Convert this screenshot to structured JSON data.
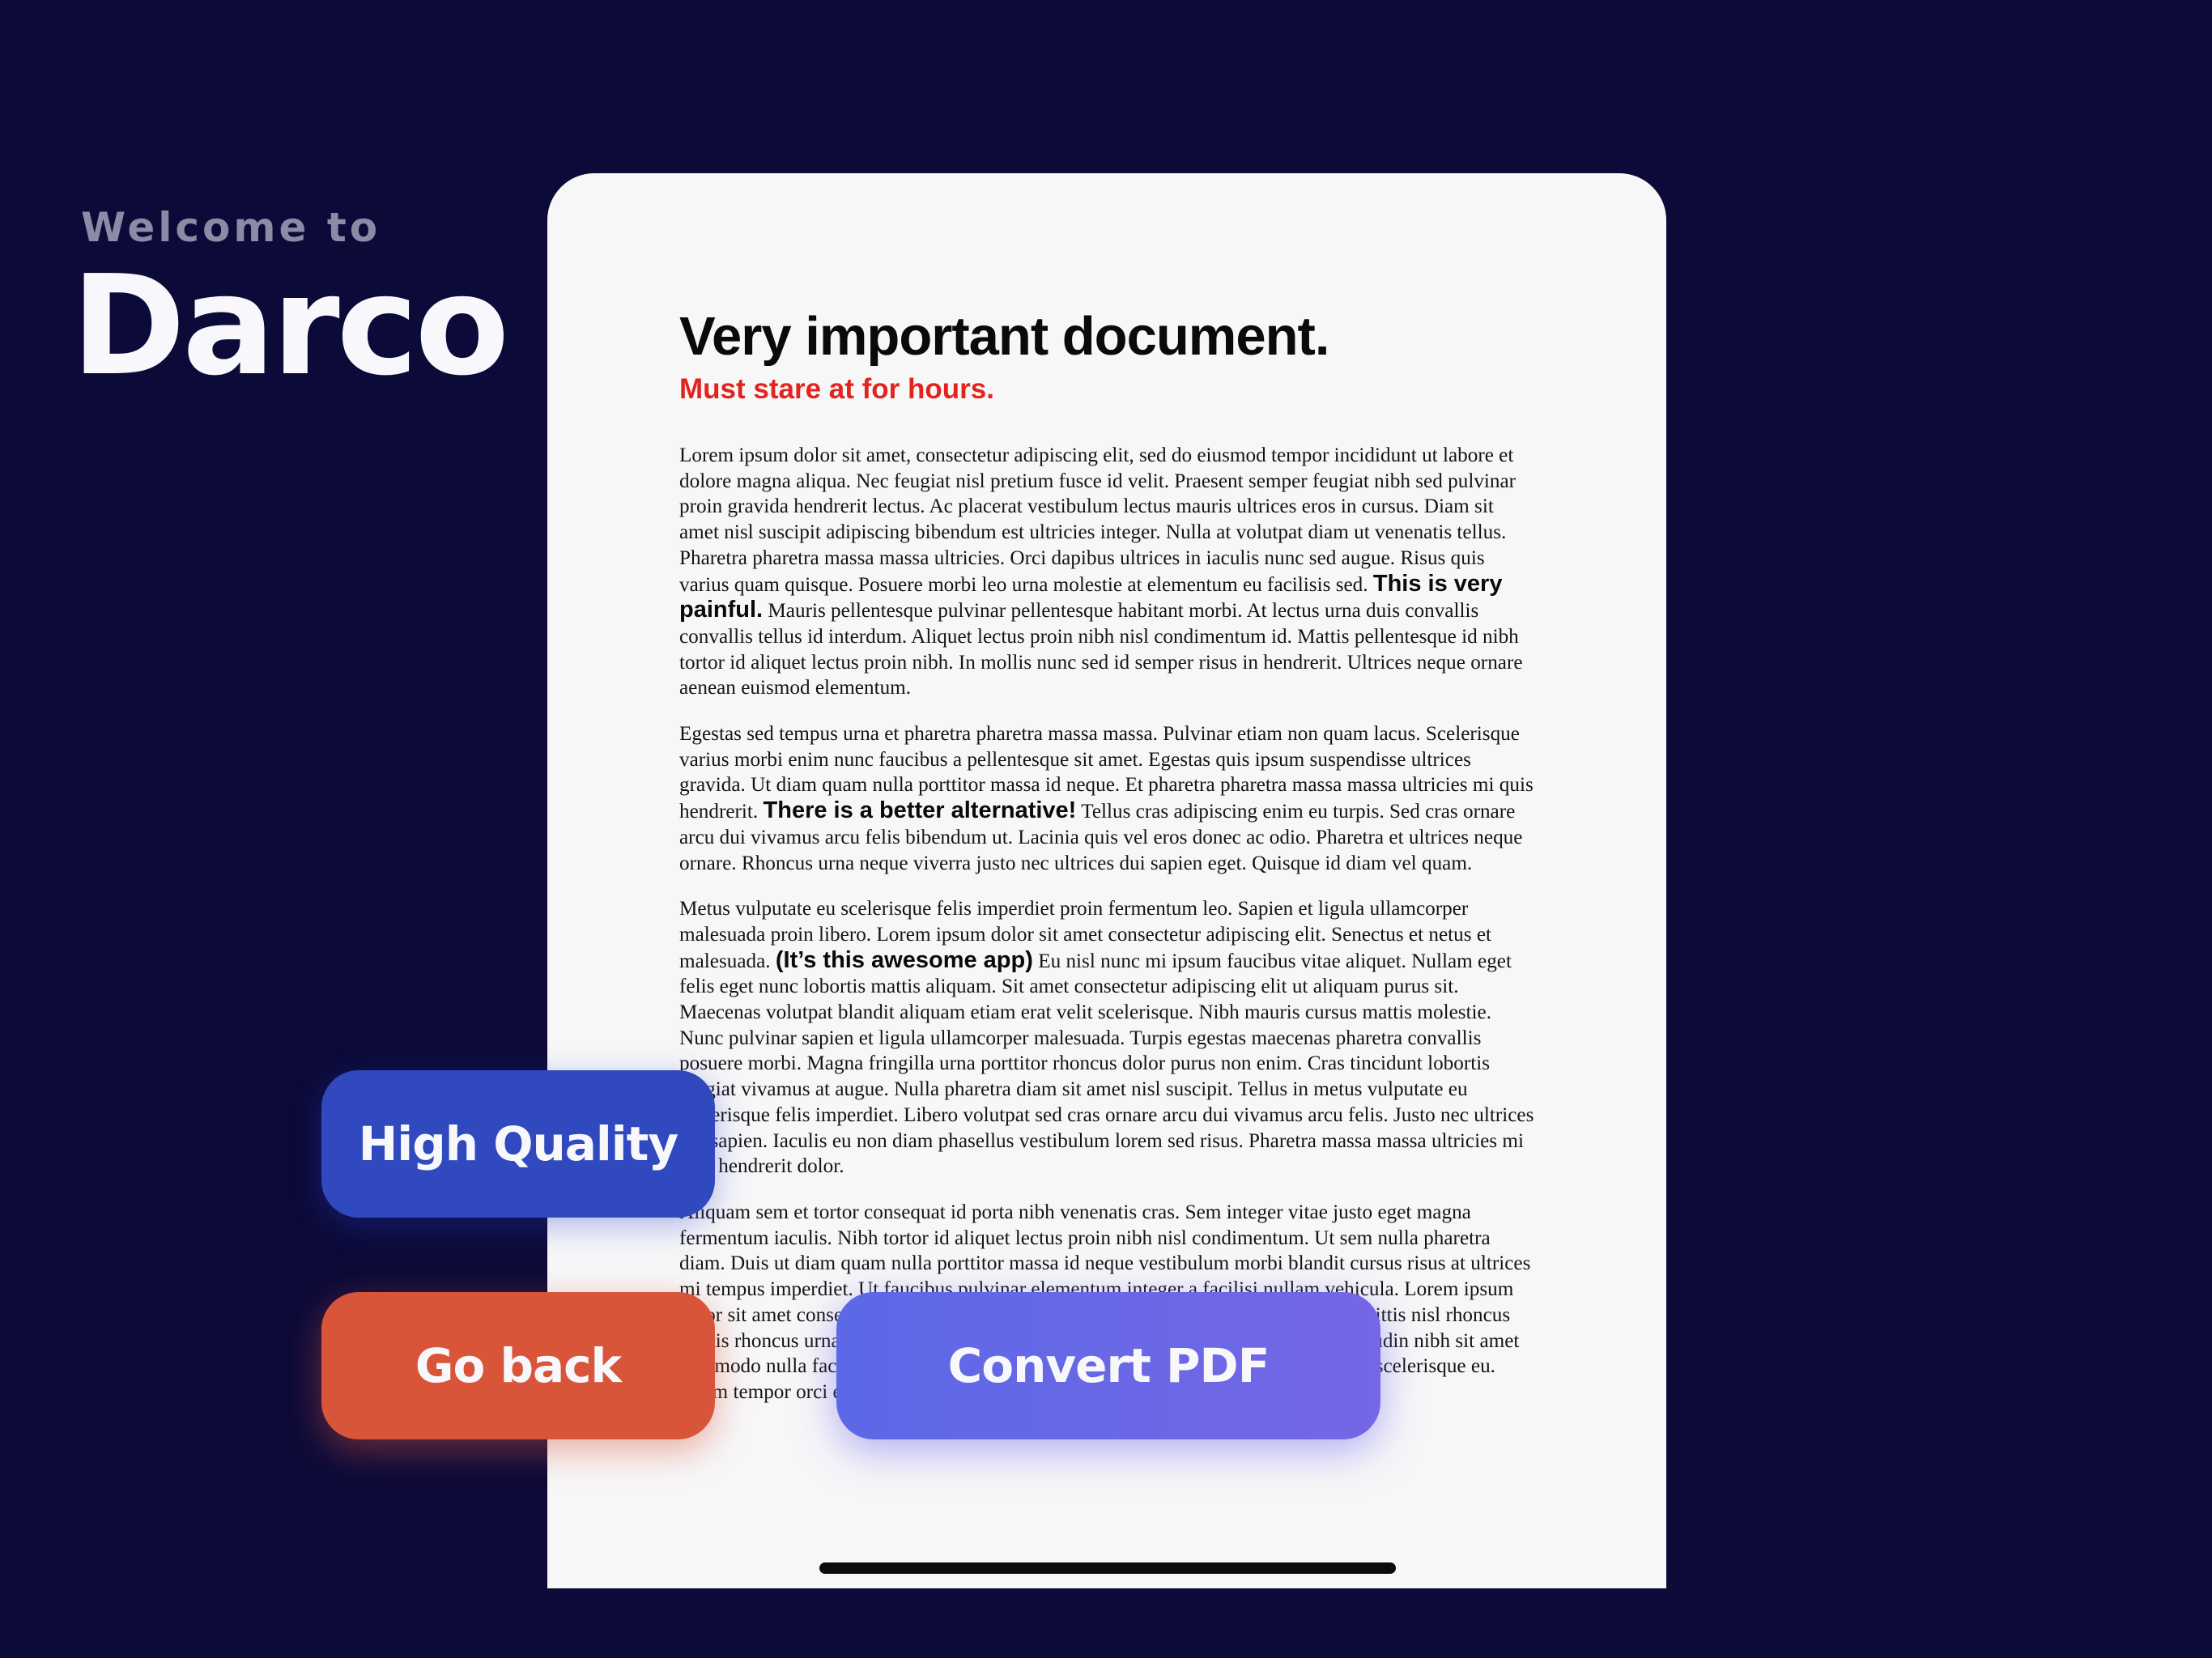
{
  "welcome": {
    "prefix": "Welcome to",
    "app_name": "Darco"
  },
  "document": {
    "title": "Very important document.",
    "subtitle": "Must stare at for hours.",
    "paragraphs": [
      {
        "before": "Lorem ipsum dolor sit amet, consectetur adipiscing elit, sed do eiusmod tempor incididunt ut labore et dolore magna aliqua. Nec feugiat nisl pretium fusce id velit. Praesent semper feugiat nibh sed pulvinar proin gravida hendrerit lectus. Ac placerat vestibulum lectus mauris ultrices eros in cursus. Diam sit amet nisl suscipit adipiscing bibendum est ultricies integer. Nulla at volutpat diam ut venenatis tellus. Pharetra pharetra massa massa ultricies. Orci dapibus ultrices in iaculis nunc sed augue. Risus quis varius quam quisque. Posuere morbi leo urna molestie at elementum eu facilisis sed.",
        "emphasis": "This is very painful.",
        "after": "Mauris pellentesque pulvinar pellentesque habitant morbi. At lectus urna duis convallis convallis tellus id interdum. Aliquet lectus proin nibh nisl condimentum id. Mattis pellentesque id nibh tortor id aliquet lectus proin nibh. In mollis nunc sed id semper risus in hendrerit. Ultrices neque ornare aenean euismod elementum."
      },
      {
        "before": "Egestas sed tempus urna et pharetra pharetra massa massa. Pulvinar etiam non quam lacus. Scelerisque varius morbi enim nunc faucibus a pellentesque sit amet. Egestas quis ipsum suspendisse ultrices gravida. Ut diam quam nulla porttitor massa id neque. Et pharetra pharetra massa massa ultricies mi quis hendrerit.",
        "emphasis": "There is a better alternative!",
        "after": "Tellus cras adipiscing enim eu turpis. Sed cras ornare arcu dui vivamus arcu felis bibendum ut. Lacinia quis vel eros donec ac odio. Pharetra et ultrices neque ornare. Rhoncus urna neque viverra justo nec ultrices dui sapien eget. Quisque id diam vel quam."
      },
      {
        "before": "Metus vulputate eu scelerisque felis imperdiet proin fermentum leo. Sapien et ligula ullamcorper malesuada proin libero. Lorem ipsum dolor sit amet consectetur adipiscing elit. Senectus et netus et malesuada.",
        "emphasis": "(It’s this awesome app)",
        "after": "Eu nisl nunc mi ipsum faucibus vitae aliquet. Nullam eget felis eget nunc lobortis mattis aliquam. Sit amet consectetur adipiscing elit ut aliquam purus sit. Maecenas volutpat blandit aliquam etiam erat velit scelerisque. Nibh mauris cursus mattis molestie. Nunc pulvinar sapien et ligula ullamcorper malesuada. Turpis egestas maecenas pharetra convallis posuere morbi. Magna fringilla urna porttitor rhoncus dolor purus non enim. Cras tincidunt lobortis feugiat vivamus at augue. Nulla pharetra diam sit amet nisl suscipit. Tellus in metus vulputate eu scelerisque felis imperdiet. Libero volutpat sed cras ornare arcu dui vivamus arcu felis. Justo nec ultrices dui sapien. Iaculis eu non diam phasellus vestibulum lorem sed risus. Pharetra massa massa ultricies mi quis hendrerit dolor."
      },
      {
        "before": "Aliquam sem et tortor consequat id porta nibh venenatis cras. Sem integer vitae justo eget magna fermentum iaculis. Nibh tortor id aliquet lectus proin nibh nisl condimentum. Ut sem nulla pharetra diam. Duis ut diam quam nulla porttitor massa id neque vestibulum morbi blandit cursus risus at ultrices mi tempus imperdiet. Ut faucibus pulvinar elementum integer a facilisi nullam vehicula. Lorem ipsum dolor sit amet consectetur adipiscing elit ut aliquam. Quam adipiscing vitae proin sagittis nisl rhoncus mattis rhoncus urna. Sed adipiscing diam donec adipiscing elit purus tristique sollicitudin nibh sit amet commodo nulla facilisi nullam vehicula volutpat. Purus viverra accumsan in nisl nisi scelerisque eu. Etiam tempor orci eu lobortis. Phasellus vestibulum",
        "emphasis": "",
        "after": ""
      }
    ]
  },
  "buttons": {
    "high_quality": "High Quality",
    "go_back": "Go back",
    "convert_pdf": "Convert PDF"
  },
  "colors": {
    "background": "#0c0a38",
    "high_quality_button": "#3049be",
    "go_back_button": "#d9553a",
    "convert_button_start": "#5c68e6",
    "convert_button_end": "#7567e6",
    "subtitle_red": "#e3241e"
  }
}
